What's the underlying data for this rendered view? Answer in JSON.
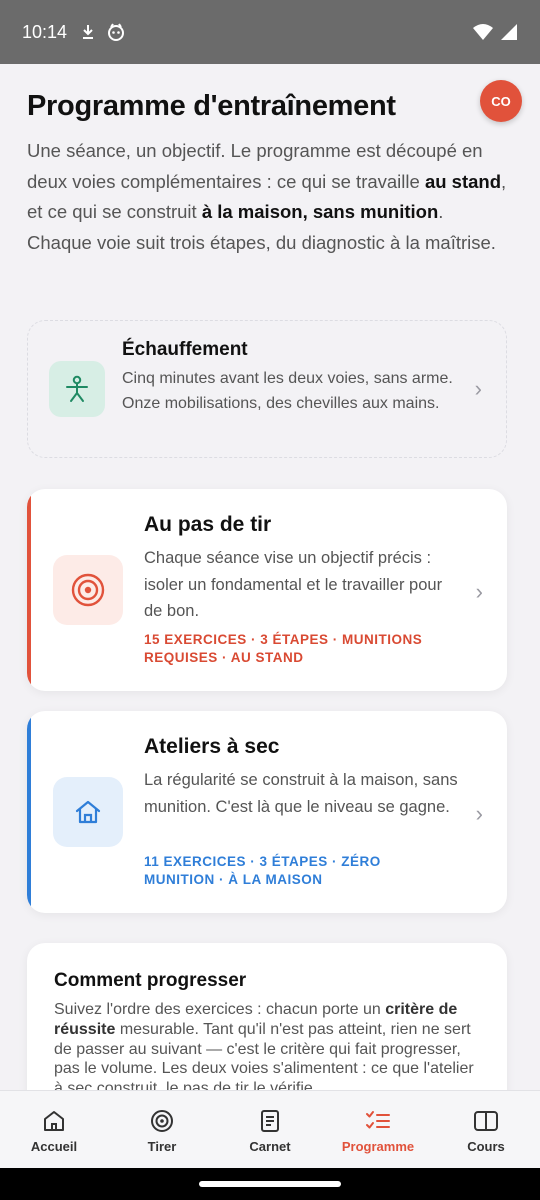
{
  "status": {
    "time": "10:14"
  },
  "header": {
    "avatar_initials": "CO",
    "title": "Programme d'entraînement",
    "intro_parts": [
      "Une séance, un objectif. Le programme est découpé en deux voies complémentaires : ce qui se travaille ",
      "au stand",
      ", et ce qui se construit ",
      "à la maison, sans munition",
      ". Chaque voie suit trois étapes, du diagnostic à la maîtrise."
    ]
  },
  "warmup": {
    "title": "Échauffement",
    "text": "Cinq minutes avant les deux voies, sans arme. Onze mobilisations, des chevilles aux mains.",
    "icon": "person-icon"
  },
  "tracks": [
    {
      "title": "Au pas de tir",
      "text": "Chaque séance vise un objectif précis : isoler un fondamental et le travailler pour de bon.",
      "meta": "15 EXERCICES · 3 ÉTAPES · MUNITIONS REQUISES · AU STAND",
      "accent": "#e1523b",
      "icon_bg": "#fdebe7",
      "icon": "target-icon"
    },
    {
      "title": "Ateliers à sec",
      "text": "La régularité se construit à la maison, sans munition. C'est là que le niveau se gagne.",
      "meta": "11 EXERCICES · 3 ÉTAPES · ZÉRO MUNITION · À LA MAISON",
      "accent": "#2f7ed8",
      "icon_bg": "#e4effb",
      "icon": "home-icon"
    }
  ],
  "progress": {
    "title": "Comment progresser",
    "text_parts": [
      "Suivez l'ordre des exercices : chacun porte un ",
      "critère de réussite",
      " mesurable. Tant qu'il n'est pas atteint, rien ne sert de passer au suivant — c'est le critère qui fait progresser, pas le volume. Les deux voies s'alimentent : ce que l'atelier à sec construit, le pas de tir le vérifie."
    ]
  },
  "nav": {
    "items": [
      {
        "label": "Accueil",
        "icon": "home-icon"
      },
      {
        "label": "Tirer",
        "icon": "target-icon"
      },
      {
        "label": "Carnet",
        "icon": "notebook-icon"
      },
      {
        "label": "Programme",
        "icon": "checklist-icon"
      },
      {
        "label": "Cours",
        "icon": "book-icon"
      }
    ],
    "active": "Programme"
  },
  "colors": {
    "accent": "#e1523b",
    "blue": "#2f7ed8",
    "green": "#1f8a63"
  }
}
